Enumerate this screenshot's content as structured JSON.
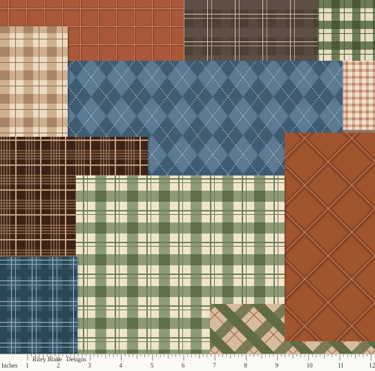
{
  "image": {
    "subject": "Plaid patchwork fabric swatch with measuring ruler",
    "palette": {
      "rust": "#9a4e31",
      "brown": "#4b3a2e",
      "dark_brown": "#3a2418",
      "tan": "#c9a889",
      "cream": "#efe2c6",
      "slate_blue": "#4f6f86",
      "teal_navy": "#2f4d5e",
      "sage": "#7d8d68",
      "olive": "#55643f"
    }
  },
  "ruler": {
    "unit_label": "Inches",
    "brand_left": "Riley Blake",
    "brand_right": "Designs",
    "numbers": [
      "1",
      "2",
      "3",
      "4",
      "5",
      "6",
      "7",
      "8",
      "9",
      "10",
      "11",
      "12"
    ]
  }
}
